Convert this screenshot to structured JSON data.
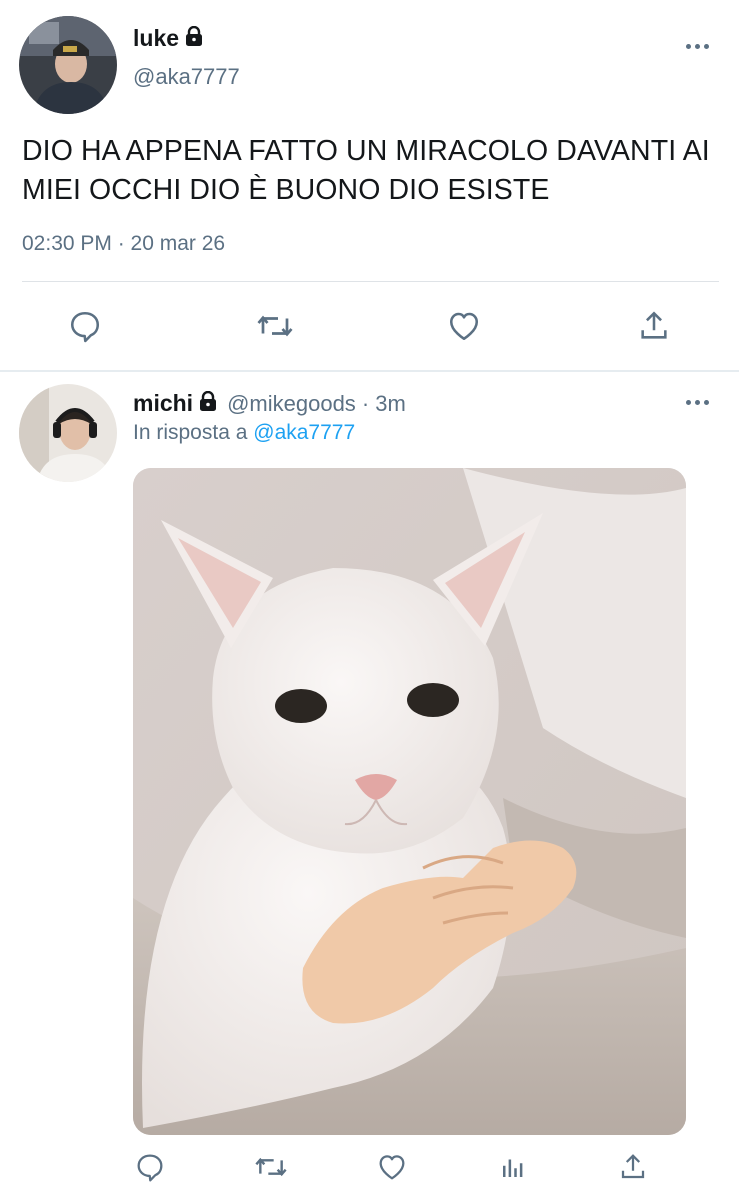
{
  "main_tweet": {
    "author_name": "luke",
    "author_handle": "@aka7777",
    "text": "DIO HA APPENA FATTO UN MIRACOLO DAVANTI AI MIEI OCCHI DIO È BUONO DIO ESISTE",
    "timestamp": "02:30 PM · 20 mar 26",
    "actions": [
      "reply-icon",
      "retweet-icon",
      "like-icon",
      "share-icon"
    ]
  },
  "reply_tweet": {
    "author_name": "michi",
    "author_handle": "@mikegoods",
    "time_ago": "· 3m",
    "reply_prefix": "In risposta a",
    "reply_to": "@aka7777",
    "media_alt_icon": "cat-photo",
    "actions": [
      "reply-icon",
      "retweet-icon",
      "like-icon",
      "analytics-icon",
      "share-icon"
    ]
  },
  "colors": {
    "text": "#14171a",
    "secondary": "#5b7083",
    "accent": "#1da1f2",
    "divider": "#dfe3e7"
  }
}
